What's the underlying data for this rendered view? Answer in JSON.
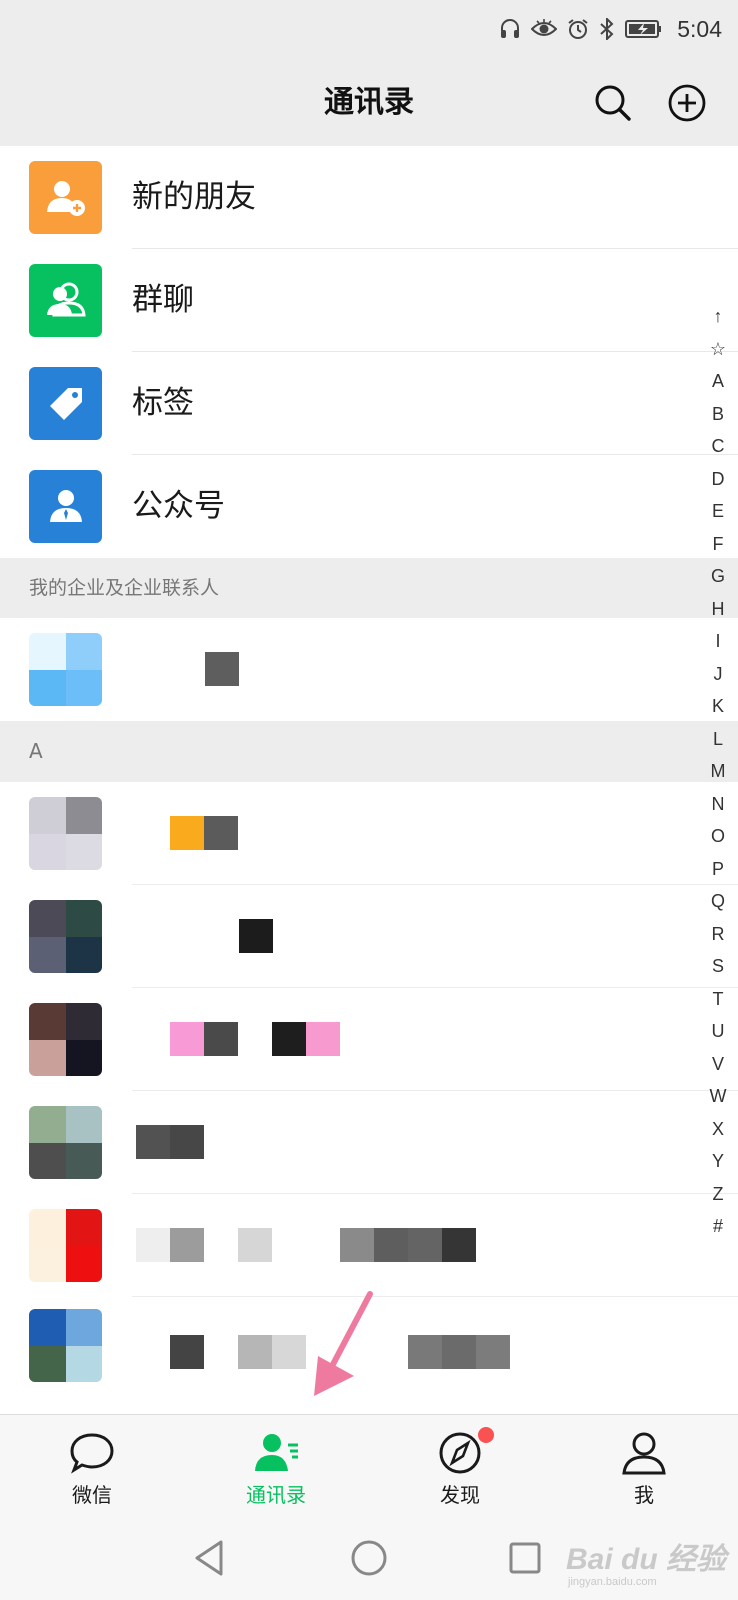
{
  "status_bar": {
    "time": "5:04",
    "icons": [
      "headset-icon",
      "eye-icon",
      "alarm-icon",
      "bluetooth-icon",
      "battery-charging-icon"
    ]
  },
  "header": {
    "title": "通讯录",
    "actions": [
      "search-icon",
      "add-circle-icon"
    ]
  },
  "functions": [
    {
      "label": "新的朋友",
      "icon": "add-friend-icon",
      "color": "#fa9d3b"
    },
    {
      "label": "群聊",
      "icon": "group-chat-icon",
      "color": "#07c160"
    },
    {
      "label": "标签",
      "icon": "tag-icon",
      "color": "#2782d7"
    },
    {
      "label": "公众号",
      "icon": "official-account-icon",
      "color": "#2782d7"
    }
  ],
  "sections": {
    "enterprise": "我的企业及企业联系人",
    "a": "A"
  },
  "index_bar": [
    "↑",
    "☆",
    "A",
    "B",
    "C",
    "D",
    "E",
    "F",
    "G",
    "H",
    "I",
    "J",
    "K",
    "L",
    "M",
    "N",
    "O",
    "P",
    "Q",
    "R",
    "S",
    "T",
    "U",
    "V",
    "W",
    "X",
    "Y",
    "Z",
    "#"
  ],
  "tabs": [
    {
      "label": "微信",
      "icon": "chat-bubble-icon",
      "active": false
    },
    {
      "label": "通讯录",
      "icon": "contacts-icon",
      "active": true
    },
    {
      "label": "发现",
      "icon": "compass-icon",
      "active": false,
      "badge": true
    },
    {
      "label": "我",
      "icon": "person-icon",
      "active": false
    }
  ],
  "navbar": [
    "back-triangle-icon",
    "home-circle-icon",
    "recents-square-icon"
  ],
  "watermark": {
    "main": "Bai du 经验",
    "sub": "jingyan.baidu.com"
  },
  "colors": {
    "accent": "#07c160",
    "header_bg": "#ededed",
    "badge": "#fa5151",
    "annotation": "#ef7aa0"
  }
}
